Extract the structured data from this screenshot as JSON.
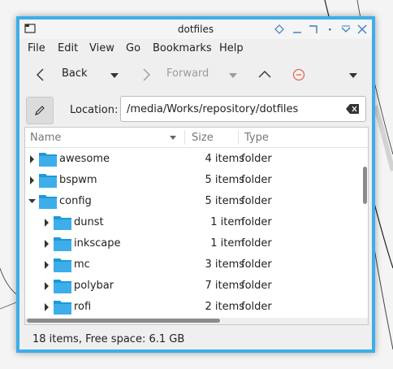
{
  "window": {
    "title": "dotfiles",
    "accent": "#3daee9"
  },
  "titlebar_buttons": [
    "keep-above-icon",
    "minimize-icon",
    "maximize-icon",
    "shade-icon",
    "close-icon"
  ],
  "menu": [
    "File",
    "Edit",
    "View",
    "Go",
    "Bookmarks",
    "Help"
  ],
  "toolbar": {
    "back_label": "Back",
    "forward_label": "Forward"
  },
  "location": {
    "label": "Location:",
    "value": "/media/Works/repository/dotfiles"
  },
  "columns": [
    "Name",
    "Size",
    "Type"
  ],
  "rows": [
    {
      "name": "awesome",
      "size": "4 items",
      "type": "folder",
      "level": 0,
      "expanded": false
    },
    {
      "name": "bspwm",
      "size": "5 items",
      "type": "folder",
      "level": 0,
      "expanded": false
    },
    {
      "name": "config",
      "size": "5 items",
      "type": "folder",
      "level": 0,
      "expanded": true
    },
    {
      "name": "dunst",
      "size": "1 item",
      "type": "folder",
      "level": 1,
      "expanded": false
    },
    {
      "name": "inkscape",
      "size": "1 item",
      "type": "folder",
      "level": 1,
      "expanded": false
    },
    {
      "name": "mc",
      "size": "3 items",
      "type": "folder",
      "level": 1,
      "expanded": false
    },
    {
      "name": "polybar",
      "size": "7 items",
      "type": "folder",
      "level": 1,
      "expanded": false
    },
    {
      "name": "rofi",
      "size": "2 items",
      "type": "folder",
      "level": 1,
      "expanded": false
    }
  ],
  "status": "18 items, Free space: 6.1 GB",
  "colors": {
    "folder": "#3daee9",
    "folder_dark": "#1d99d8",
    "stop": "#e8645a"
  }
}
